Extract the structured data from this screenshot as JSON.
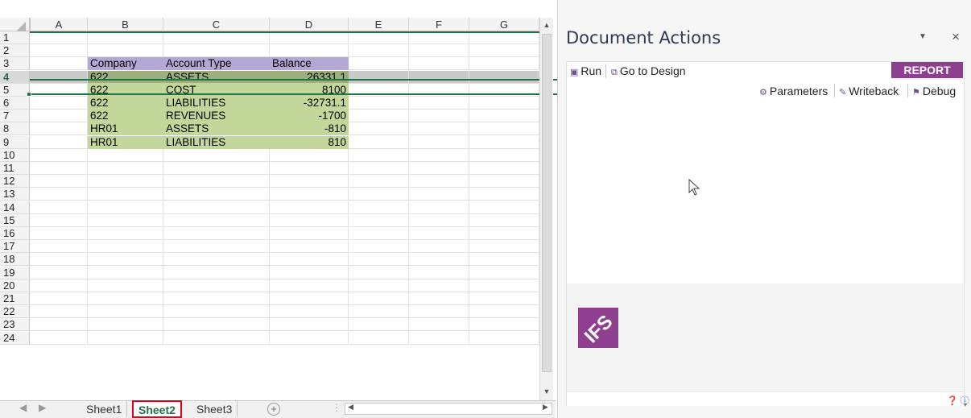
{
  "spreadsheet": {
    "columns": [
      "A",
      "B",
      "C",
      "D",
      "E",
      "F",
      "G"
    ],
    "rows": [
      {
        "n": "1",
        "cells": [
          "",
          "",
          "",
          ""
        ]
      },
      {
        "n": "2",
        "cells": [
          "",
          "",
          "",
          ""
        ]
      },
      {
        "n": "3",
        "cells": [
          "",
          "Company",
          "Account Type",
          "Balance"
        ],
        "kind": "hdr"
      },
      {
        "n": "4",
        "cells": [
          "",
          "622",
          "ASSETS",
          "26331.1"
        ],
        "kind": "data",
        "selected": true
      },
      {
        "n": "5",
        "cells": [
          "",
          "622",
          "COST",
          "8100"
        ],
        "kind": "data"
      },
      {
        "n": "6",
        "cells": [
          "",
          "622",
          "LIABILITIES",
          "-32731.1"
        ],
        "kind": "data"
      },
      {
        "n": "7",
        "cells": [
          "",
          "622",
          "REVENUES",
          "-1700"
        ],
        "kind": "data"
      },
      {
        "n": "8",
        "cells": [
          "",
          "HR01",
          "ASSETS",
          "-810"
        ],
        "kind": "data"
      },
      {
        "n": "9",
        "cells": [
          "",
          "HR01",
          "LIABILITIES",
          "810"
        ],
        "kind": "data"
      },
      {
        "n": "10",
        "cells": [
          "",
          "",
          "",
          ""
        ]
      },
      {
        "n": "11",
        "cells": [
          "",
          "",
          "",
          ""
        ]
      },
      {
        "n": "12",
        "cells": [
          "",
          "",
          "",
          ""
        ]
      },
      {
        "n": "13",
        "cells": [
          "",
          "",
          "",
          ""
        ]
      },
      {
        "n": "14",
        "cells": [
          "",
          "",
          "",
          ""
        ]
      },
      {
        "n": "15",
        "cells": [
          "",
          "",
          "",
          ""
        ]
      },
      {
        "n": "16",
        "cells": [
          "",
          "",
          "",
          ""
        ]
      },
      {
        "n": "17",
        "cells": [
          "",
          "",
          "",
          ""
        ]
      },
      {
        "n": "18",
        "cells": [
          "",
          "",
          "",
          ""
        ]
      },
      {
        "n": "19",
        "cells": [
          "",
          "",
          "",
          ""
        ]
      },
      {
        "n": "20",
        "cells": [
          "",
          "",
          "",
          ""
        ]
      },
      {
        "n": "21",
        "cells": [
          "",
          "",
          "",
          ""
        ]
      },
      {
        "n": "22",
        "cells": [
          "",
          "",
          "",
          ""
        ]
      },
      {
        "n": "23",
        "cells": [
          "",
          "",
          "",
          ""
        ]
      },
      {
        "n": "24",
        "cells": [
          "",
          "",
          "",
          ""
        ]
      }
    ],
    "colors": {
      "header_fill": "#b4a7d6",
      "data_fill": "#c4d79b",
      "selection": "#217346"
    }
  },
  "sheet_tabs": {
    "tabs": [
      "Sheet1",
      "Sheet2",
      "Sheet3"
    ],
    "active": "Sheet2",
    "add_symbol": "+"
  },
  "task_pane": {
    "title": "Document Actions",
    "dropdown_icon": "chevron-down-icon",
    "close_label": "×",
    "toolbar": {
      "run_label": "Run",
      "go_to_design_label": "Go to Design",
      "mode_badge": "REPORT MODE",
      "parameters_label": "Parameters",
      "writeback_label": "Writeback",
      "debug_label": "Debug"
    },
    "logo_text": "IFS",
    "brand_color": "#8e3f8f"
  }
}
